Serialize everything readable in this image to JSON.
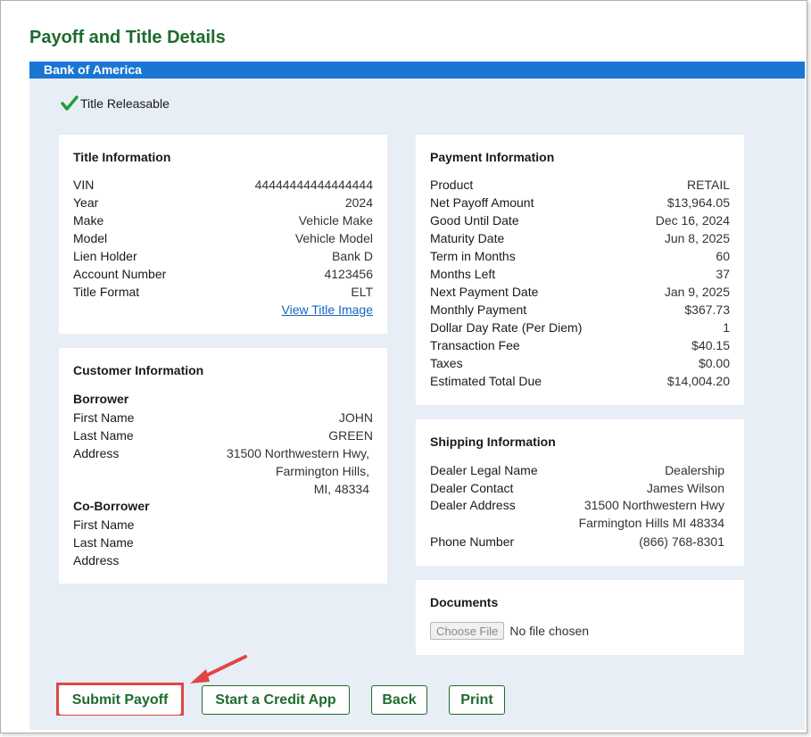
{
  "page": {
    "title": "Payoff and Title Details"
  },
  "bank": {
    "name": "Bank of America"
  },
  "status": {
    "label": "Title Releasable"
  },
  "title_info": {
    "heading": "Title Information",
    "rows": [
      {
        "label": "VIN",
        "value": "44444444444444444"
      },
      {
        "label": "Year",
        "value": "2024"
      },
      {
        "label": "Make",
        "value": "Vehicle Make"
      },
      {
        "label": "Model",
        "value": "Vehicle Model"
      },
      {
        "label": "Lien Holder",
        "value": "Bank D"
      },
      {
        "label": "Account Number",
        "value": "4123456"
      },
      {
        "label": "Title Format",
        "value": "ELT"
      }
    ],
    "link": "View Title Image"
  },
  "customer": {
    "heading": "Customer Information",
    "borrower_heading": "Borrower",
    "borrower": {
      "first_name_label": "First Name",
      "first_name": "JOHN",
      "last_name_label": "Last Name",
      "last_name": "GREEN",
      "address_label": "Address",
      "address_lines": [
        "31500 Northwestern Hwy,",
        "Farmington Hills,",
        "MI, 48334"
      ]
    },
    "coborrower_heading": "Co-Borrower",
    "coborrower": {
      "first_name_label": "First Name",
      "last_name_label": "Last Name",
      "address_label": "Address"
    }
  },
  "payment": {
    "heading": "Payment Information",
    "rows": [
      {
        "label": "Product",
        "value": "RETAIL"
      },
      {
        "label": "Net Payoff Amount",
        "value": "$13,964.05"
      },
      {
        "label": "Good Until Date",
        "value": "Dec 16, 2024"
      },
      {
        "label": "Maturity Date",
        "value": "Jun 8, 2025"
      },
      {
        "label": "Term in Months",
        "value": "60"
      },
      {
        "label": "Months Left",
        "value": "37"
      },
      {
        "label": "Next Payment Date",
        "value": "Jan 9, 2025"
      },
      {
        "label": "Monthly Payment",
        "value": "$367.73"
      },
      {
        "label": "Dollar Day Rate (Per Diem)",
        "value": "1"
      },
      {
        "label": "Transaction Fee",
        "value": "$40.15"
      },
      {
        "label": "Taxes",
        "value": "$0.00"
      },
      {
        "label": "Estimated Total Due",
        "value": "$14,004.20"
      }
    ]
  },
  "shipping": {
    "heading": "Shipping Information",
    "legal_name_label": "Dealer Legal Name",
    "legal_name": "Dealership",
    "contact_label": "Dealer Contact",
    "contact": "James Wilson",
    "address_label": "Dealer Address",
    "address_lines": [
      "31500 Northwestern Hwy",
      "Farmington Hills MI 48334"
    ],
    "phone_label": "Phone Number",
    "phone": "(866) 768-8301"
  },
  "documents": {
    "heading": "Documents",
    "choose_file": "Choose File",
    "file_status": "No file chosen"
  },
  "actions": {
    "submit": "Submit Payoff",
    "credit_app": "Start a Credit App",
    "back": "Back",
    "print": "Print"
  },
  "colors": {
    "brand_green": "#1e6b2e",
    "bank_bar": "#1976d2",
    "highlight_red": "#e04646",
    "panel_bg": "#e8eef6"
  }
}
